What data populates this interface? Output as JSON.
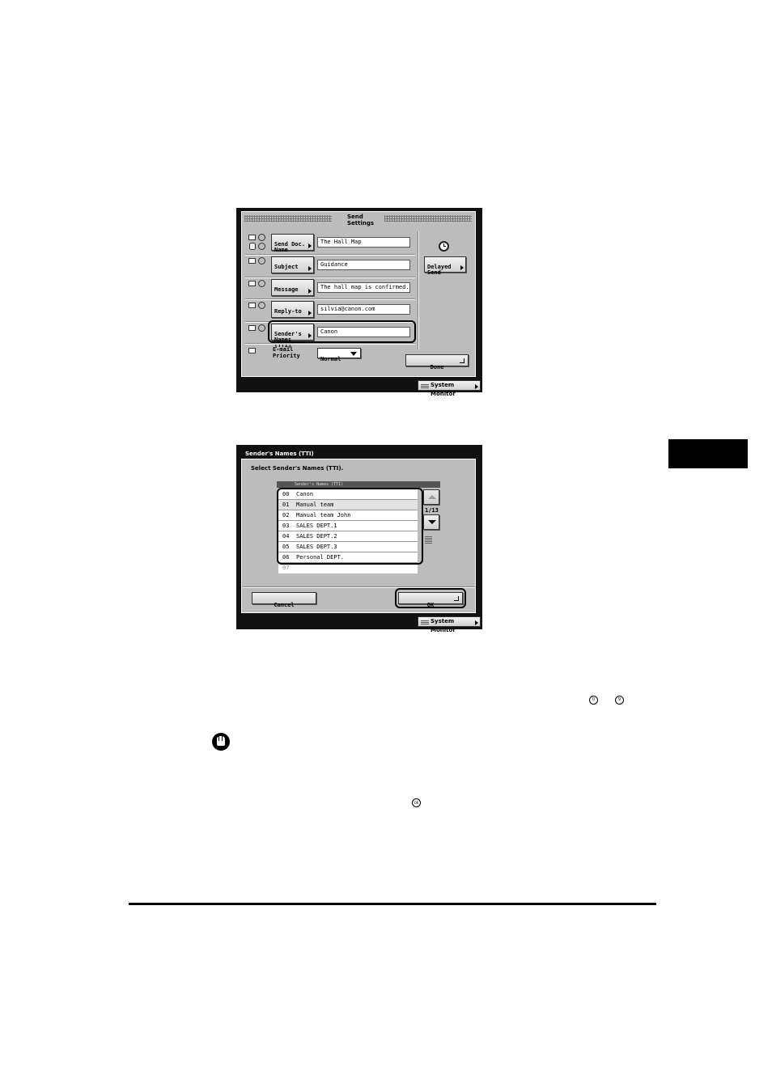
{
  "send_settings": {
    "title": "Send\nSettings",
    "rows": [
      {
        "button": "Send Doc.\nName",
        "value": "The Hall Map"
      },
      {
        "button": "Subject",
        "value": "Guidance"
      },
      {
        "button": "Message",
        "value": "The hall map is confirmed."
      },
      {
        "button": "Reply-to",
        "value": "silvia@canon.com"
      },
      {
        "button": "Sender's\nNames (TTI)",
        "value": "Canon"
      }
    ],
    "priority": {
      "label": "E-mail\nPriority",
      "value": "Normal"
    },
    "delayed_send": "Delayed\nSend",
    "done": "Done",
    "system_monitor": "System Monitor"
  },
  "senders_dialog": {
    "title": "Sender's Names (TTI)",
    "instruction": "Select Sender's Names (TTI).",
    "list_header": "Sender's Names (TTI)",
    "items": [
      {
        "num": "00",
        "name": "Canon"
      },
      {
        "num": "01",
        "name": "Manual team"
      },
      {
        "num": "02",
        "name": "Manual team John"
      },
      {
        "num": "03",
        "name": "SALES DEPT.1"
      },
      {
        "num": "04",
        "name": "SALES DEPT.2"
      },
      {
        "num": "05",
        "name": "SALES DEPT.3"
      },
      {
        "num": "06",
        "name": "Personal DEPT."
      },
      {
        "num": "07",
        "name": ""
      }
    ],
    "page": "1/13",
    "cancel": "Cancel",
    "ok": "OK",
    "system_monitor": "System Monitor"
  },
  "key_icons": {
    "zero": "0",
    "nine": "9",
    "ok": "OK"
  }
}
